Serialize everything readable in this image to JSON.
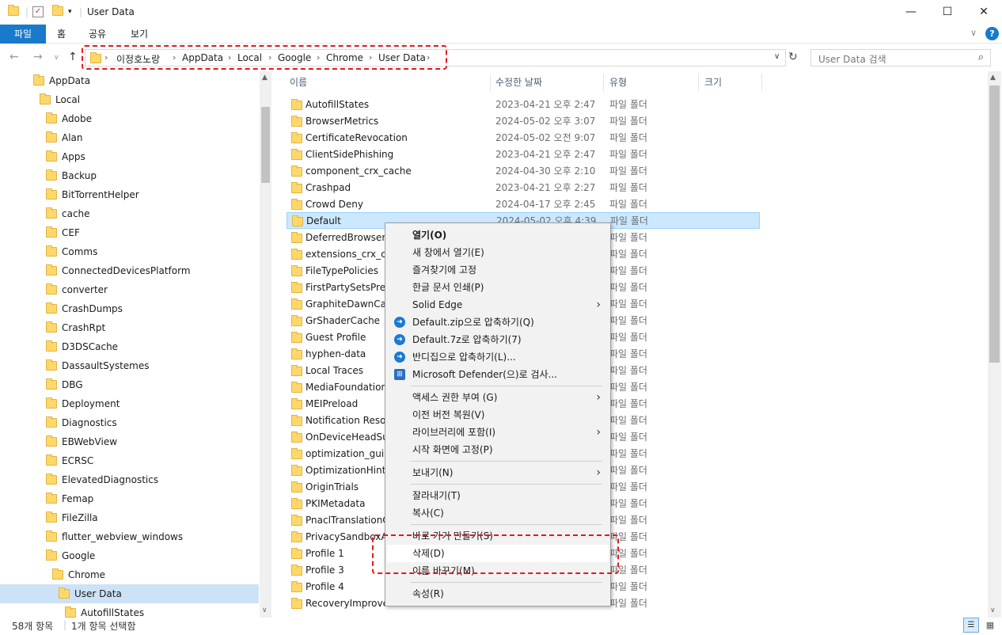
{
  "window": {
    "title": "User Data",
    "minimize": "—",
    "maximize": "☐",
    "close": "✕"
  },
  "ribbon": {
    "tabs": [
      "파일",
      "홈",
      "공유",
      "보기"
    ]
  },
  "nav": {
    "breadcrumb": [
      "이정호노랑",
      "AppData",
      "Local",
      "Google",
      "Chrome",
      "User Data"
    ],
    "search_placeholder": "User Data 검색"
  },
  "tree": [
    {
      "label": "AppData",
      "level": 0
    },
    {
      "label": "Local",
      "level": 1
    },
    {
      "label": "Adobe",
      "level": 2
    },
    {
      "label": "Alan",
      "level": 2
    },
    {
      "label": "Apps",
      "level": 2
    },
    {
      "label": "Backup",
      "level": 2
    },
    {
      "label": "BitTorrentHelper",
      "level": 2
    },
    {
      "label": "cache",
      "level": 2
    },
    {
      "label": "CEF",
      "level": 2
    },
    {
      "label": "Comms",
      "level": 2
    },
    {
      "label": "ConnectedDevicesPlatform",
      "level": 2
    },
    {
      "label": "converter",
      "level": 2
    },
    {
      "label": "CrashDumps",
      "level": 2
    },
    {
      "label": "CrashRpt",
      "level": 2
    },
    {
      "label": "D3DSCache",
      "level": 2
    },
    {
      "label": "DassaultSystemes",
      "level": 2
    },
    {
      "label": "DBG",
      "level": 2
    },
    {
      "label": "Deployment",
      "level": 2
    },
    {
      "label": "Diagnostics",
      "level": 2
    },
    {
      "label": "EBWebView",
      "level": 2
    },
    {
      "label": "ECRSC",
      "level": 2
    },
    {
      "label": "ElevatedDiagnostics",
      "level": 2
    },
    {
      "label": "Femap",
      "level": 2
    },
    {
      "label": "FileZilla",
      "level": 2
    },
    {
      "label": "flutter_webview_windows",
      "level": 2
    },
    {
      "label": "Google",
      "level": 2
    },
    {
      "label": "Chrome",
      "level": 3
    },
    {
      "label": "User Data",
      "level": 4,
      "selected": true
    },
    {
      "label": "AutofillStates",
      "level": 5
    }
  ],
  "columns": {
    "name": "이름",
    "date": "수정한 날짜",
    "type": "유형",
    "size": "크기"
  },
  "files": [
    {
      "name": "AutofillStates",
      "date": "2023-04-21 오후 2:47",
      "type": "파일 폴더"
    },
    {
      "name": "BrowserMetrics",
      "date": "2024-05-02 오후 3:07",
      "type": "파일 폴더"
    },
    {
      "name": "CertificateRevocation",
      "date": "2024-05-02 오전 9:07",
      "type": "파일 폴더"
    },
    {
      "name": "ClientSidePhishing",
      "date": "2023-04-21 오후 2:47",
      "type": "파일 폴더"
    },
    {
      "name": "component_crx_cache",
      "date": "2024-04-30 오후 2:10",
      "type": "파일 폴더"
    },
    {
      "name": "Crashpad",
      "date": "2023-04-21 오후 2:27",
      "type": "파일 폴더"
    },
    {
      "name": "Crowd Deny",
      "date": "2024-04-17 오후 2:45",
      "type": "파일 폴더"
    },
    {
      "name": "Default",
      "date": "2024-05-02 오후 4:39",
      "type": "파일 폴더",
      "selected": true
    },
    {
      "name": "DeferredBrowserMetrics",
      "date": "",
      "type": "파일 폴더"
    },
    {
      "name": "extensions_crx_cache",
      "date": "",
      "type": "파일 폴더"
    },
    {
      "name": "FileTypePolicies",
      "date": "",
      "type": "파일 폴더"
    },
    {
      "name": "FirstPartySetsPreloaded",
      "date": "",
      "type": "파일 폴더"
    },
    {
      "name": "GraphiteDawnCache",
      "date": "",
      "type": "파일 폴더"
    },
    {
      "name": "GrShaderCache",
      "date": "",
      "type": "파일 폴더"
    },
    {
      "name": "Guest Profile",
      "date": "",
      "type": "파일 폴더"
    },
    {
      "name": "hyphen-data",
      "date": "",
      "type": "파일 폴더"
    },
    {
      "name": "Local Traces",
      "date": "",
      "type": "파일 폴더"
    },
    {
      "name": "MediaFoundationWidevineCdm",
      "date": "",
      "type": "파일 폴더"
    },
    {
      "name": "MEIPreload",
      "date": "",
      "type": "파일 폴더"
    },
    {
      "name": "Notification Resources",
      "date": "",
      "type": "파일 폴더"
    },
    {
      "name": "OnDeviceHeadSuggestModel",
      "date": "",
      "type": "파일 폴더"
    },
    {
      "name": "optimization_guide_model_store",
      "date": "",
      "type": "파일 폴더"
    },
    {
      "name": "OptimizationHints",
      "date": "",
      "type": "파일 폴더"
    },
    {
      "name": "OriginTrials",
      "date": "",
      "type": "파일 폴더"
    },
    {
      "name": "PKIMetadata",
      "date": "",
      "type": "파일 폴더"
    },
    {
      "name": "PnaclTranslationCache",
      "date": "",
      "type": "파일 폴더"
    },
    {
      "name": "PrivacySandboxAttestationsPreloaded",
      "date": "",
      "type": "파일 폴더"
    },
    {
      "name": "Profile 1",
      "date": "",
      "type": "파일 폴더"
    },
    {
      "name": "Profile 3",
      "date": "",
      "type": "파일 폴더"
    },
    {
      "name": "Profile 4",
      "date": "",
      "type": "파일 폴더"
    },
    {
      "name": "RecoveryImproved",
      "date": "",
      "type": "파일 폴더"
    }
  ],
  "status": {
    "count": "58개 항목",
    "selected": "1개 항목 선택함"
  },
  "context_menu": {
    "items": [
      {
        "label": "열기(O)",
        "bold": true
      },
      {
        "label": "새 창에서 열기(E)"
      },
      {
        "label": "즐겨찾기에 고정"
      },
      {
        "label": "한글 문서 인쇄(P)"
      },
      {
        "label": "Solid Edge",
        "submenu": true
      },
      {
        "label": "Default.zip으로 압축하기(Q)",
        "icon": "bandizip-icon"
      },
      {
        "label": "Default.7z로 압축하기(7)",
        "icon": "bandizip-icon"
      },
      {
        "label": "반디집으로 압축하기(L)...",
        "icon": "bandizip-icon"
      },
      {
        "label": "Microsoft Defender(으)로 검사...",
        "icon": "defender-icon"
      },
      {
        "separator": true
      },
      {
        "label": "액세스 권한 부여 (G)",
        "submenu": true
      },
      {
        "label": "이전 버전 복원(V)"
      },
      {
        "label": "라이브러리에 포함(I)",
        "submenu": true
      },
      {
        "label": "시작 화면에 고정(P)"
      },
      {
        "separator": true
      },
      {
        "label": "보내기(N)",
        "submenu": true
      },
      {
        "separator": true
      },
      {
        "label": "잘라내기(T)"
      },
      {
        "label": "복사(C)"
      },
      {
        "separator": true
      },
      {
        "label": "바로 가기 만들기(S)"
      },
      {
        "label": "삭제(D)",
        "highlighted": true
      },
      {
        "label": "이름 바꾸기(M)"
      },
      {
        "separator": true
      },
      {
        "label": "속성(R)"
      }
    ]
  },
  "colors": {
    "accent": "#1979ca",
    "selection": "#cce8ff",
    "annotation": "#e5171c"
  }
}
